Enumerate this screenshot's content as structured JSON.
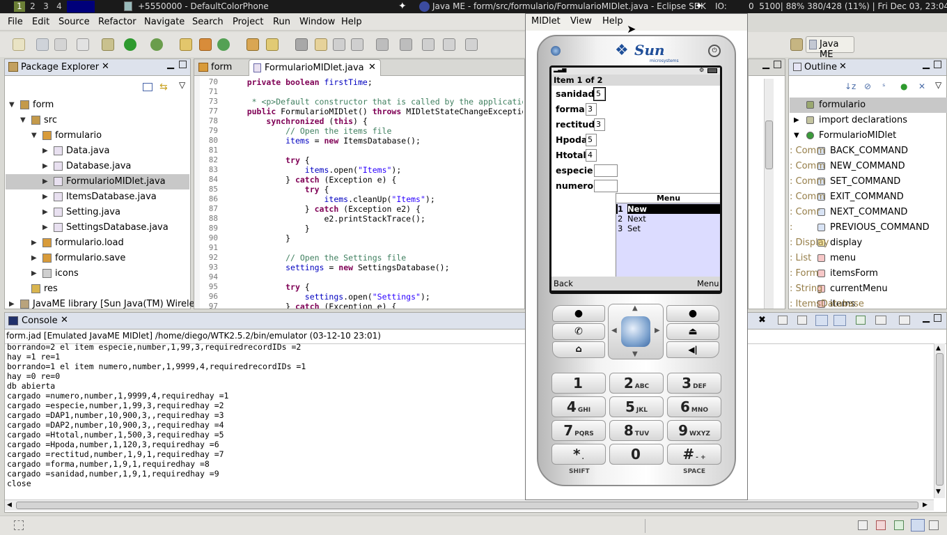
{
  "topbar": {
    "workspaces": [
      "1",
      "2",
      "3",
      "4"
    ],
    "task_phone": "+5550000 - DefaultColorPhone",
    "task_eclipse": "Java ME - form/src/formulario/FormularioMIDlet.java - Eclipse SDK",
    "io": "IO:",
    "stats": "0  5100| 88% 380/428 (11%) | Fri Dec 03, 23:04"
  },
  "menubar": [
    "File",
    "Edit",
    "Source",
    "Refactor",
    "Navigate",
    "Search",
    "Project",
    "Run",
    "Window",
    "Help"
  ],
  "perspective": {
    "label": "Java ME"
  },
  "package_explorer": {
    "title": "Package Explorer",
    "rows": [
      {
        "label": "form"
      },
      {
        "label": "src"
      },
      {
        "label": "formulario"
      },
      {
        "label": "Data.java"
      },
      {
        "label": "Database.java"
      },
      {
        "label": "FormularioMIDlet.java"
      },
      {
        "label": "ItemsDatabase.java"
      },
      {
        "label": "Setting.java"
      },
      {
        "label": "SettingsDatabase.java"
      },
      {
        "label": "formulario.load"
      },
      {
        "label": "formulario.save"
      },
      {
        "label": "icons"
      },
      {
        "label": "res"
      },
      {
        "label": "JavaME library [Sun Java(TM) Wirele"
      }
    ]
  },
  "editor": {
    "tabs": [
      {
        "label": "form"
      },
      {
        "label": "FormularioMIDlet.java"
      }
    ],
    "lines": [
      {
        "n": "70",
        "t": "    private boolean firstTime;"
      },
      {
        "n": "71",
        "t": ""
      },
      {
        "n": "73",
        "t": "     * <p>Default constructor that is called by the applicatio"
      },
      {
        "n": "77",
        "t": "    public FormularioMIDlet() throws MIDletStateChangeExceptio"
      },
      {
        "n": "78",
        "t": "        synchronized (this) {"
      },
      {
        "n": "79",
        "t": "            // Open the items file"
      },
      {
        "n": "80",
        "t": "            items = new ItemsDatabase();"
      },
      {
        "n": "81",
        "t": ""
      },
      {
        "n": "82",
        "t": "            try {"
      },
      {
        "n": "83",
        "t": "                items.open(\"Items\");"
      },
      {
        "n": "84",
        "t": "            } catch (Exception e) {"
      },
      {
        "n": "85",
        "t": "                try {"
      },
      {
        "n": "86",
        "t": "                    items.cleanUp(\"Items\");"
      },
      {
        "n": "87",
        "t": "                } catch (Exception e2) {"
      },
      {
        "n": "88",
        "t": "                    e2.printStackTrace();"
      },
      {
        "n": "89",
        "t": "                }"
      },
      {
        "n": "90",
        "t": "            }"
      },
      {
        "n": "91",
        "t": ""
      },
      {
        "n": "92",
        "t": "            // Open the Settings file"
      },
      {
        "n": "93",
        "t": "            settings = new SettingsDatabase();"
      },
      {
        "n": "94",
        "t": ""
      },
      {
        "n": "95",
        "t": "            try {"
      },
      {
        "n": "96",
        "t": "                settings.open(\"Settings\");"
      },
      {
        "n": "97",
        "t": "            } catch (Exception e) {"
      }
    ]
  },
  "outline": {
    "title": "Outline",
    "rows": [
      {
        "label": "formulario",
        "type": ""
      },
      {
        "label": "import declarations",
        "type": ""
      },
      {
        "label": "FormularioMIDlet",
        "type": ""
      },
      {
        "label": "BACK_COMMAND",
        "type": " : Comm"
      },
      {
        "label": "NEW_COMMAND",
        "type": " : Comm"
      },
      {
        "label": "SET_COMMAND",
        "type": " : Comm"
      },
      {
        "label": "EXIT_COMMAND",
        "type": " : Comm"
      },
      {
        "label": "NEXT_COMMAND",
        "type": " : Comr"
      },
      {
        "label": "PREVIOUS_COMMAND",
        "type": " :"
      },
      {
        "label": "display",
        "type": " : Display"
      },
      {
        "label": "menu",
        "type": " : List"
      },
      {
        "label": "itemsForm",
        "type": " : Form"
      },
      {
        "label": "currentMenu",
        "type": " : String"
      },
      {
        "label": "items",
        "type": " : ItemsDatabase"
      }
    ]
  },
  "console": {
    "title": "Console",
    "header": "form.jad [Emulated JavaME MIDlet] /home/diego/WTK2.5.2/bin/emulator (03-12-10 23:01)",
    "lines": [
      "borrando=2 el item especie,number,1,99,3,requiredrecordIDs =2",
      "hay =1 re=1",
      "borrando=1 el item numero,number,1,9999,4,requiredrecordIDs =1",
      "hay =0 re=0",
      "db abierta",
      "cargado =numero,number,1,9999,4,requiredhay =1",
      "cargado =especie,number,1,99,3,requiredhay =2",
      "cargado =DAP1,number,10,900,3,,requiredhay =3",
      "cargado =DAP2,number,10,900,3,,requiredhay =4",
      "cargado =Htotal,number,1,500,3,requiredhay =5",
      "cargado =Hpoda,number,1,120,3,requiredhay =6",
      "cargado =rectitud,number,1,9,1,requiredhay =7",
      "cargado =forma,number,1,9,1,requiredhay =8",
      "cargado =sanidad,number,1,9,1,requiredhay =9",
      "close"
    ]
  },
  "emulator": {
    "menu": [
      "MIDlet",
      "View",
      "Help"
    ],
    "brand": "Sun",
    "brand_sub": "microsystems",
    "title": "Item 1 of 2",
    "fields": [
      {
        "label": "sanidad",
        "value": "5"
      },
      {
        "label": "forma",
        "value": "3"
      },
      {
        "label": "rectitud",
        "value": "3"
      },
      {
        "label": "Hpoda",
        "value": "5"
      },
      {
        "label": "Htotal",
        "value": "4"
      },
      {
        "label": "especie",
        "value": ""
      },
      {
        "label": "numero",
        "value": ""
      }
    ],
    "popup_title": "Menu",
    "popup_items": [
      {
        "num": "1",
        "label": "New"
      },
      {
        "num": "2",
        "label": "Next"
      },
      {
        "num": "3",
        "label": "Set"
      }
    ],
    "soft_left": "Back",
    "soft_right": "Menu",
    "keys": [
      {
        "n": "1",
        "s": ""
      },
      {
        "n": "2",
        "s": "ABC"
      },
      {
        "n": "3",
        "s": "DEF"
      },
      {
        "n": "4",
        "s": "GHI"
      },
      {
        "n": "5",
        "s": "JKL"
      },
      {
        "n": "6",
        "s": "MNO"
      },
      {
        "n": "7",
        "s": "PQRS"
      },
      {
        "n": "8",
        "s": "TUV"
      },
      {
        "n": "9",
        "s": "WXYZ"
      },
      {
        "n": "*",
        "s": "."
      },
      {
        "n": "0",
        "s": ""
      },
      {
        "n": "#",
        "s": "- +"
      }
    ],
    "shift": "SHIFT",
    "space": "SPACE"
  },
  "colors": {
    "keyword": "#7f0055",
    "comment": "#3f7f5f",
    "string": "#2a00ff",
    "field": "#0000c0",
    "selection": "#c8c8c8"
  }
}
